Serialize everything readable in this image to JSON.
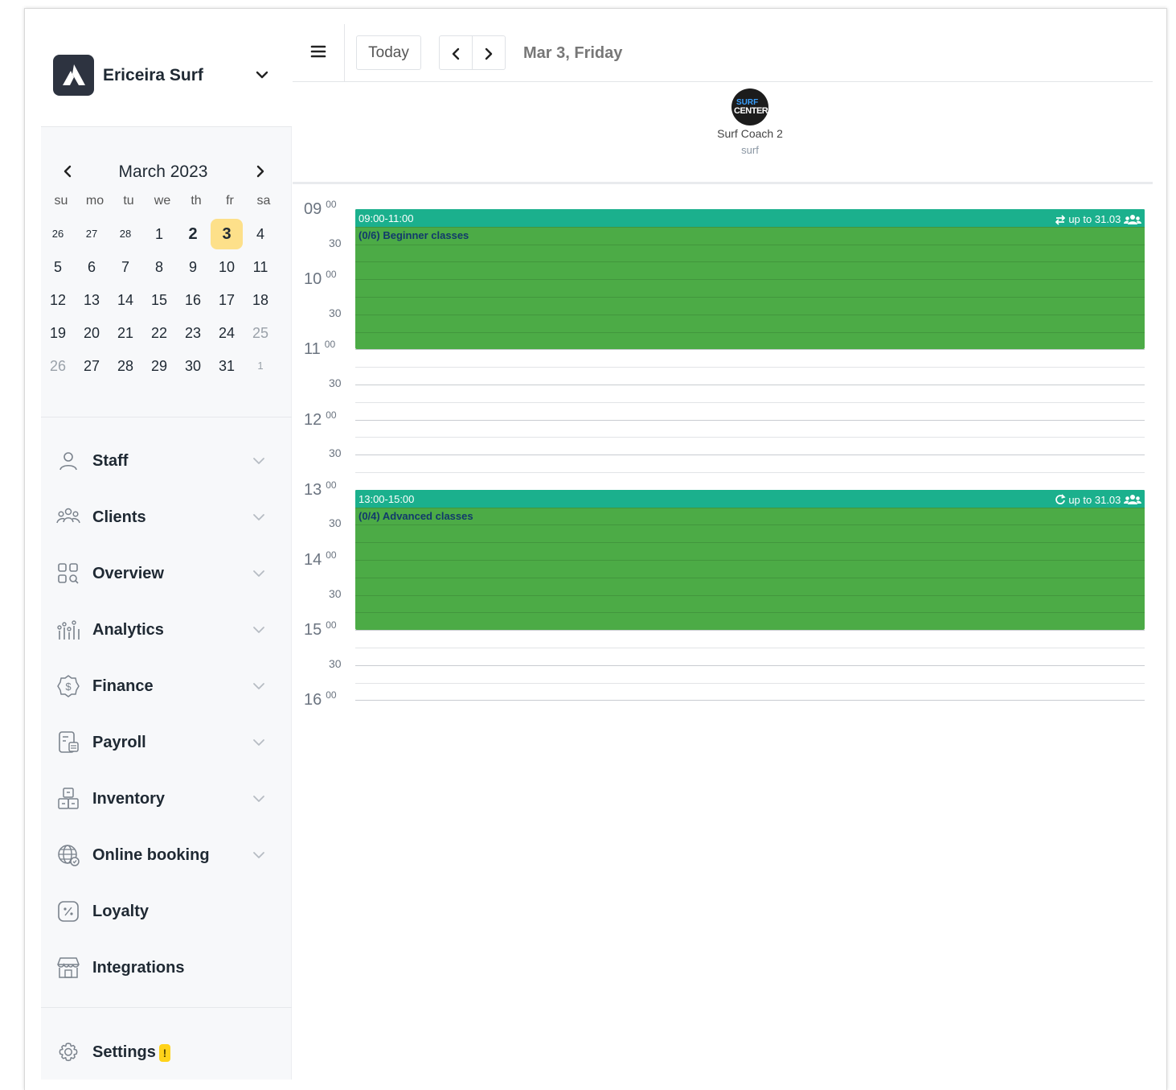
{
  "brand": {
    "name": "Ericeira Surf"
  },
  "calendar": {
    "month_label": "March 2023",
    "weekdays": [
      "su",
      "mo",
      "tu",
      "we",
      "th",
      "fr",
      "sa"
    ],
    "weeks": [
      [
        "26",
        "27",
        "28",
        "1",
        "2",
        "3",
        "4"
      ],
      [
        "5",
        "6",
        "7",
        "8",
        "9",
        "10",
        "11"
      ],
      [
        "12",
        "13",
        "14",
        "15",
        "16",
        "17",
        "18"
      ],
      [
        "19",
        "20",
        "21",
        "22",
        "23",
        "24",
        "25"
      ],
      [
        "26",
        "27",
        "28",
        "29",
        "30",
        "31",
        "1"
      ]
    ],
    "selected_day": "3"
  },
  "nav": {
    "items": [
      {
        "label": "Staff",
        "icon": "user-icon",
        "has_submenu": true
      },
      {
        "label": "Clients",
        "icon": "users-group-icon",
        "has_submenu": true
      },
      {
        "label": "Overview",
        "icon": "grid-search-icon",
        "has_submenu": true
      },
      {
        "label": "Analytics",
        "icon": "analytics-icon",
        "has_submenu": true
      },
      {
        "label": "Finance",
        "icon": "dollar-badge-icon",
        "has_submenu": true
      },
      {
        "label": "Payroll",
        "icon": "payroll-icon",
        "has_submenu": true
      },
      {
        "label": "Inventory",
        "icon": "boxes-icon",
        "has_submenu": true
      },
      {
        "label": "Online booking",
        "icon": "globe-icon",
        "has_submenu": true
      },
      {
        "label": "Loyalty",
        "icon": "percent-icon",
        "has_submenu": false
      },
      {
        "label": "Integrations",
        "icon": "store-icon",
        "has_submenu": false
      }
    ],
    "settings": {
      "label": "Settings",
      "badge": "!",
      "icon": "gear-icon"
    }
  },
  "toolbar": {
    "today_label": "Today",
    "date_title": "Mar 3, Friday"
  },
  "staff": {
    "name": "Surf Coach 2",
    "role": "surf",
    "avatar_text_top": "SURF",
    "avatar_text_bottom": "CENTER"
  },
  "timeline": {
    "hours": [
      "09",
      "10",
      "11",
      "12",
      "13",
      "14",
      "15",
      "16"
    ],
    "minute_top": "00",
    "minute_half": "30"
  },
  "events": [
    {
      "time": "09:00-11:00",
      "title": "(0/6) Beginner classes",
      "repeat_label": "up to 31.03",
      "repeat_icon": "repeat-arrows-icon",
      "group_icon": "group-icon"
    },
    {
      "time": "13:00-15:00",
      "title": "(0/4) Advanced classes",
      "repeat_label": "up to 31.03",
      "repeat_icon": "refresh-icon",
      "group_icon": "group-icon"
    }
  ],
  "colors": {
    "event_fill": "#4cab46",
    "event_header": "#1bb08d",
    "selected_day": "#fde08a",
    "badge": "#ffd31a"
  }
}
